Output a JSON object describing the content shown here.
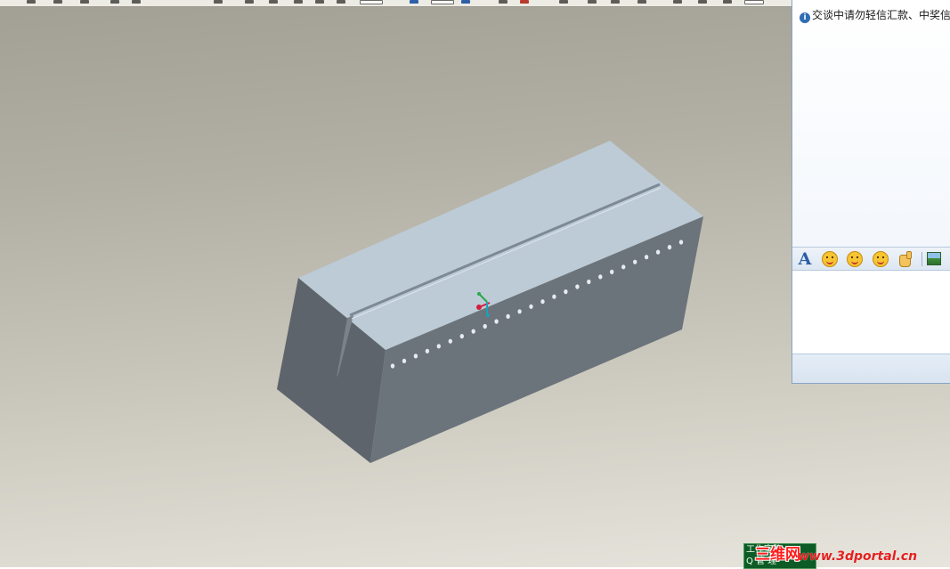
{
  "app": {
    "viewport_label": "3D model viewport"
  },
  "colors": {
    "top_face": "#bccbd6",
    "front_face": "#6b737b",
    "left_face": "#5d646b",
    "groove": "#7c8a96",
    "dots": "#e6ebee",
    "chat_border": "#8aa4c2"
  },
  "chat": {
    "notice": "交谈中请勿轻信汇款、中奖信息",
    "tools": [
      "font-icon",
      "smile-emoji-icon",
      "grin-emoji-icon",
      "wink-emoji-icon",
      "hand-icon",
      "image-icon"
    ]
  },
  "watermark": {
    "box_line1": "工作室路",
    "box_line2": "Q 管 理",
    "logo": "三维网",
    "url": "www.3dportal.cn"
  }
}
